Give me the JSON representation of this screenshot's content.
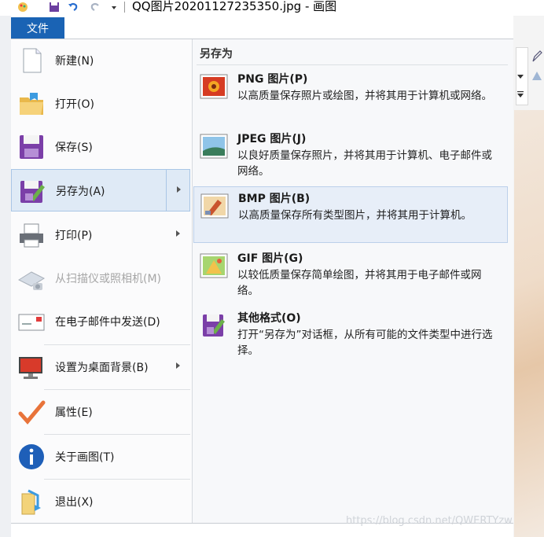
{
  "window": {
    "title": "QQ图片20201127235350.jpg - 画图"
  },
  "file_tab": {
    "label": "文件"
  },
  "menu": {
    "items": [
      {
        "label": "新建(N)",
        "icon": "new-file-icon"
      },
      {
        "label": "打开(O)",
        "icon": "open-folder-icon"
      },
      {
        "label": "保存(S)",
        "icon": "save-disk-icon"
      },
      {
        "label": "另存为(A)",
        "icon": "save-as-icon",
        "selected": true,
        "has_submenu": true
      },
      {
        "label": "打印(P)",
        "icon": "printer-icon",
        "has_submenu": true
      },
      {
        "label": "从扫描仪或照相机(M)",
        "icon": "scanner-icon",
        "disabled": true
      },
      {
        "label": "在电子邮件中发送(D)",
        "icon": "email-icon"
      },
      {
        "label": "设置为桌面背景(B)",
        "icon": "desktop-icon",
        "has_submenu": true
      },
      {
        "label": "属性(E)",
        "icon": "checkmark-icon"
      },
      {
        "label": "关于画图(T)",
        "icon": "info-icon"
      },
      {
        "label": "退出(X)",
        "icon": "exit-icon"
      }
    ]
  },
  "save_as": {
    "title": "另存为",
    "formats": [
      {
        "name": "PNG 图片(P)",
        "desc": "以高质量保存照片或绘图，并将其用于计算机或网络。",
        "icon": "png-image-icon"
      },
      {
        "name": "JPEG 图片(J)",
        "desc": "以良好质量保存照片，并将其用于计算机、电子邮件或网络。",
        "icon": "jpeg-image-icon"
      },
      {
        "name": "BMP 图片(B)",
        "desc": "以高质量保存所有类型图片，并将其用于计算机。",
        "icon": "bmp-image-icon",
        "highlighted": true
      },
      {
        "name": "GIF 图片(G)",
        "desc": "以较低质量保存简单绘图，并将其用于电子邮件或网络。",
        "icon": "gif-image-icon"
      },
      {
        "name": "其他格式(O)",
        "desc": "打开“另存为”对话框，从所有可能的文件类型中进行选择。",
        "icon": "other-format-icon"
      }
    ]
  },
  "watermark": "https://blog.csdn.net/QWERTYzw",
  "colors": {
    "accent": "#1a63b4",
    "selected_bg": "#dfeaf6",
    "highlight_bg": "#e7eef8"
  }
}
